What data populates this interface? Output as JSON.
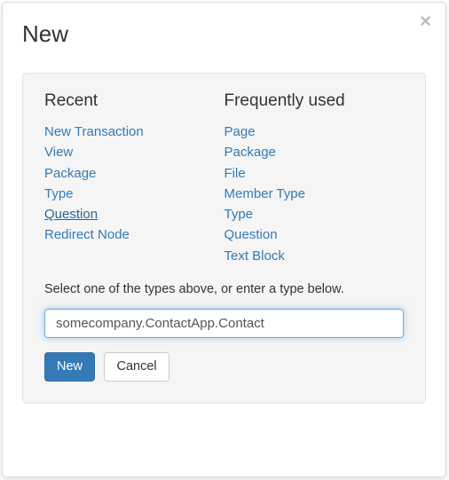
{
  "title": "New",
  "closeIcon": "×",
  "recent": {
    "heading": "Recent",
    "items": [
      "New Transaction",
      "View",
      "Package",
      "Type",
      "Question",
      "Redirect Node"
    ],
    "hoverIndex": 4
  },
  "frequent": {
    "heading": "Frequently used",
    "items": [
      "Page",
      "Package",
      "File",
      "Member Type",
      "Type",
      "Question",
      "Text Block"
    ]
  },
  "instruction": "Select one of the types above, or enter a type below.",
  "typeInput": {
    "value": "somecompany.ContactApp.Contact"
  },
  "buttons": {
    "submit": "New",
    "cancel": "Cancel"
  }
}
